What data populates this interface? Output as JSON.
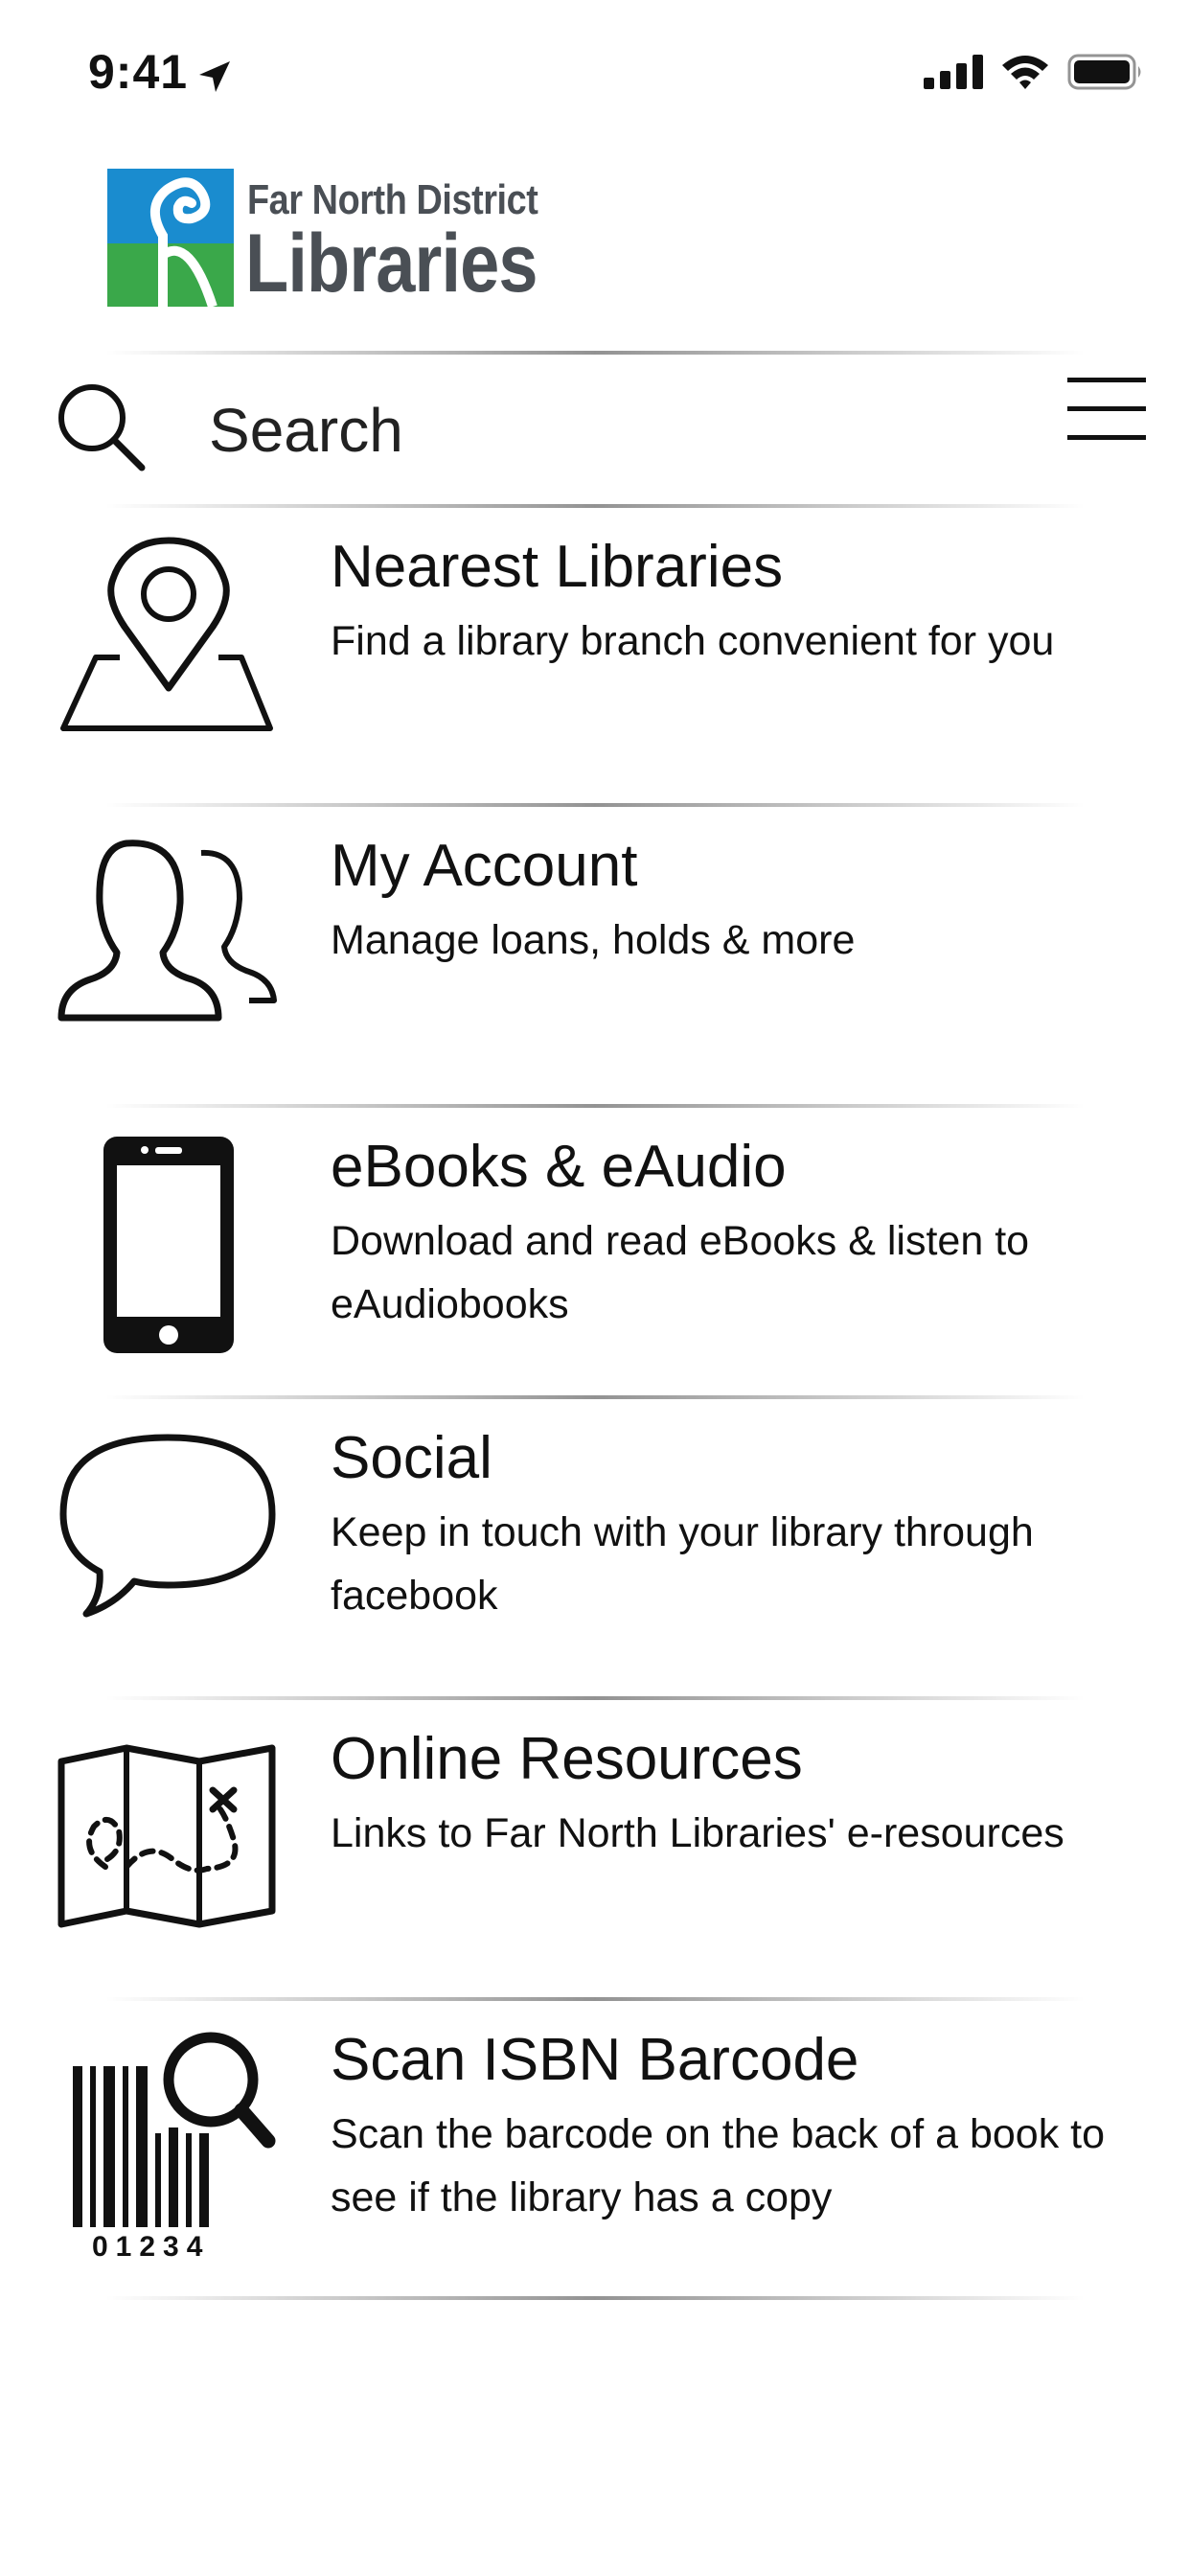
{
  "status_bar": {
    "time": "9:41"
  },
  "logo": {
    "line1": "Far North District",
    "line2": "Libraries"
  },
  "search": {
    "placeholder": "Search"
  },
  "menu": [
    {
      "title": "Nearest Libraries",
      "description": "Find a library branch convenient for you",
      "icon": "map-pin-icon"
    },
    {
      "title": "My Account",
      "description": "Manage loans, holds & more",
      "icon": "users-icon"
    },
    {
      "title": "eBooks & eAudio",
      "description": "Download and read eBooks & listen to eAudiobooks",
      "icon": "smartphone-icon"
    },
    {
      "title": "Social",
      "description": "Keep in touch with your library through facebook",
      "icon": "speech-bubble-icon"
    },
    {
      "title": "Online Resources",
      "description": "Links to Far North Libraries' e-resources",
      "icon": "treasure-map-icon"
    },
    {
      "title": "Scan ISBN Barcode",
      "description": "Scan the barcode on the back of a book to see if the library has a copy",
      "icon": "barcode-search-icon"
    }
  ],
  "barcode_digits": "01234",
  "colors": {
    "logo_blue": "#1a8ccf",
    "logo_green": "#3aa84a",
    "logo_text": "#4a4f55"
  }
}
